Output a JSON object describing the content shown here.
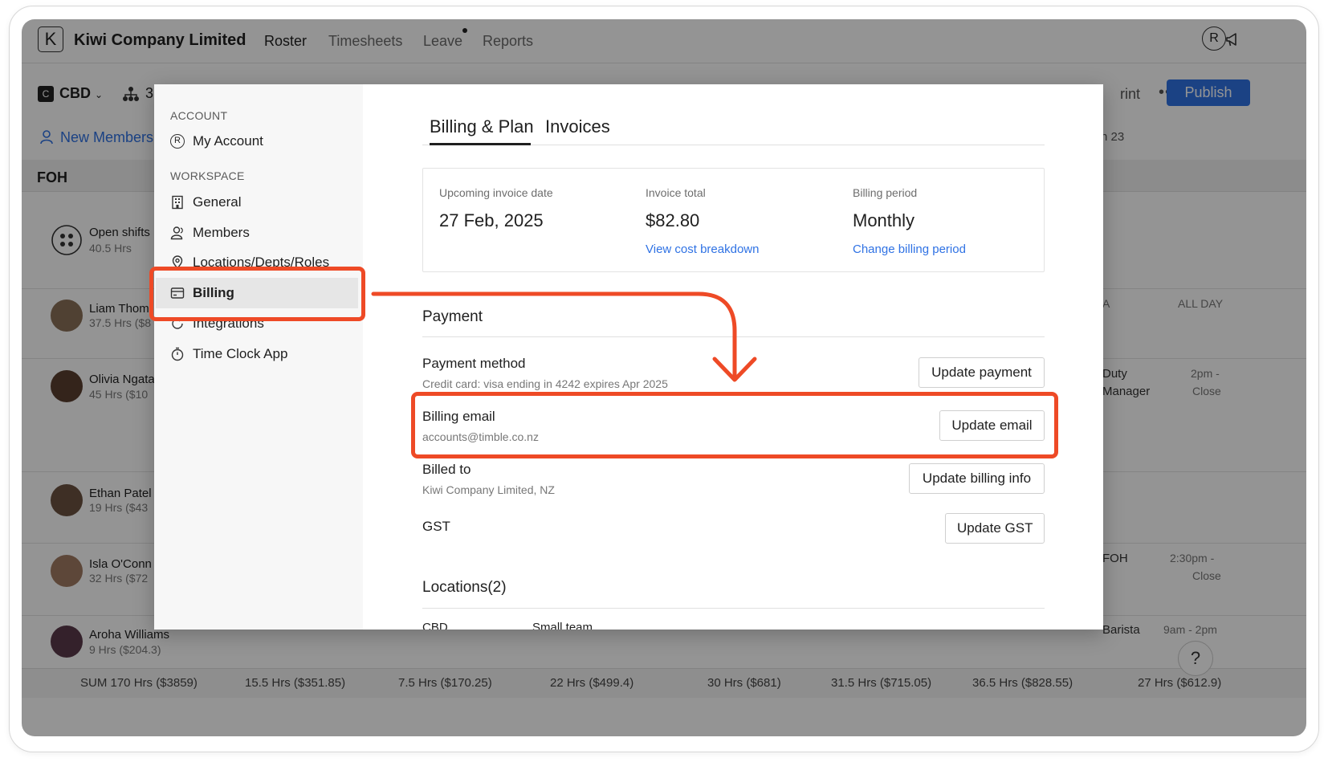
{
  "app": {
    "logo_letter": "K",
    "company": "Kiwi Company Limited",
    "nav": [
      "Roster",
      "Timesheets",
      "Leave",
      "Reports"
    ],
    "avatar_initial": "R"
  },
  "toolbar": {
    "location_badge": "C",
    "location": "CBD",
    "org_count": "3",
    "print_label": "rint",
    "more": "•••",
    "publish": "Publish",
    "new_members": "New Members",
    "date_header": "n 23"
  },
  "section": {
    "label": "FOH"
  },
  "employees": [
    {
      "name": "Open shifts",
      "hrs": "40.5 Hrs"
    },
    {
      "name": "Liam Thom",
      "hrs": "37.5 Hrs ($8"
    },
    {
      "name": "Olivia Ngata",
      "hrs": "45 Hrs ($10"
    },
    {
      "name": "Ethan Patel",
      "hrs": "19 Hrs ($43"
    },
    {
      "name": "Isla O'Conn",
      "hrs": "32 Hrs ($72"
    },
    {
      "name": "Aroha Williams",
      "hrs": "9 Hrs ($204.3)"
    }
  ],
  "right_cells": {
    "liam_a": "A",
    "liam_allday": "ALL DAY",
    "olivia_role": "Duty",
    "olivia_role2": "Manager",
    "olivia_time": "2pm -",
    "olivia_time2": "Close",
    "isla_role": "FOH",
    "isla_time": "2:30pm -",
    "isla_time2": "Close",
    "aroha_role": "Barista",
    "aroha_time": "9am - 2pm"
  },
  "sum_row": [
    "SUM 170 Hrs ($3859)",
    "15.5 Hrs ($351.85)",
    "7.5 Hrs ($170.25)",
    "22 Hrs ($499.4)",
    "30 Hrs ($681)",
    "31.5 Hrs ($715.05)",
    "36.5 Hrs ($828.55)",
    "27 Hrs ($612.9)"
  ],
  "help": "?",
  "settings": {
    "account_header": "ACCOUNT",
    "my_account": "My Account",
    "workspace_header": "WORKSPACE",
    "items": [
      "General",
      "Members",
      "Locations/Depts/Roles",
      "Billing",
      "Integrations",
      "Time Clock App"
    ]
  },
  "billing": {
    "tabs": [
      "Billing & Plan",
      "Invoices"
    ],
    "summary": {
      "upcoming_label": "Upcoming invoice date",
      "upcoming_value": "27 Feb, 2025",
      "total_label": "Invoice total",
      "total_value": "$82.80",
      "total_link": "View cost breakdown",
      "period_label": "Billing period",
      "period_value": "Monthly",
      "period_link": "Change billing period"
    },
    "payment": {
      "title": "Payment",
      "method_label": "Payment method",
      "method_sub": "Credit card: visa ending in 4242 expires Apr 2025",
      "update_payment": "Update payment",
      "email_label": "Billing email",
      "email_value": "accounts@timble.co.nz",
      "update_email": "Update email",
      "billed_label": "Billed to",
      "billed_value": "Kiwi Company Limited, NZ",
      "update_billing": "Update billing info",
      "gst_label": "GST",
      "update_gst": "Update GST"
    },
    "locations": {
      "title": "Locations(2)",
      "row_name": "CBD",
      "row_plan": "Small team"
    }
  },
  "colors": {
    "accent": "#2f72e4",
    "annotation": "#ee4a26"
  }
}
